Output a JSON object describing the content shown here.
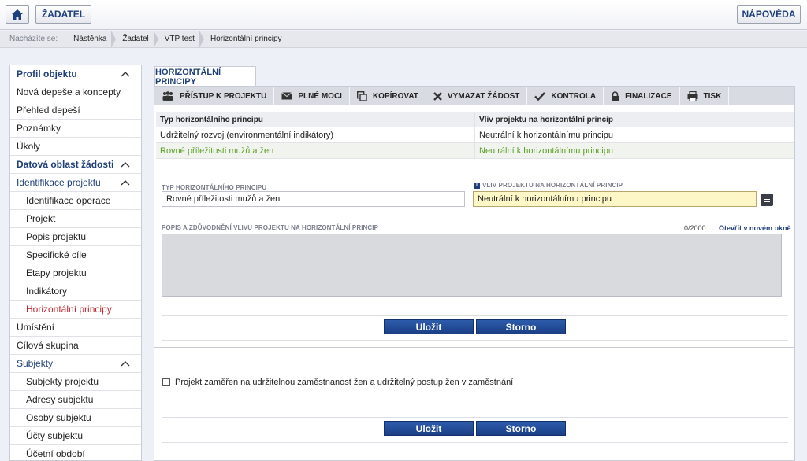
{
  "topbar": {
    "home_icon": "home-icon",
    "zadatel_label": "ŽADATEL",
    "napoveda_label": "NÁPOVĚDA"
  },
  "breadcrumb": {
    "lead": "Nacházíte se:",
    "items": [
      "Nástěnka",
      "Žadatel",
      "VTP test",
      "Horizontální principy"
    ]
  },
  "sidebar": {
    "items": [
      {
        "label": "Profil objektu"
      },
      {
        "label": "Nová depeše a koncepty"
      },
      {
        "label": "Přehled depeší"
      },
      {
        "label": "Poznámky"
      },
      {
        "label": "Úkoly"
      },
      {
        "label": "Datová oblast žádosti"
      },
      {
        "label": "Identifikace projektu"
      },
      {
        "label": "Identifikace operace"
      },
      {
        "label": "Projekt"
      },
      {
        "label": "Popis projektu"
      },
      {
        "label": "Specifické cíle"
      },
      {
        "label": "Etapy projektu"
      },
      {
        "label": "Indikátory"
      },
      {
        "label": "Horizontální principy"
      },
      {
        "label": "Umístění"
      },
      {
        "label": "Cílová skupina"
      },
      {
        "label": "Subjekty"
      },
      {
        "label": "Subjekty projektu"
      },
      {
        "label": "Adresy subjektu"
      },
      {
        "label": "Osoby subjektu"
      },
      {
        "label": "Účty subjektu"
      },
      {
        "label": "Účetní období"
      }
    ]
  },
  "tab": {
    "title": "HORIZONTÁLNÍ PRINCIPY"
  },
  "toolbar": {
    "items": [
      {
        "label": "PŘÍSTUP K PROJEKTU",
        "icon": "people-icon"
      },
      {
        "label": "PLNÉ MOCI",
        "icon": "envelope-icon"
      },
      {
        "label": "KOPÍROVAT",
        "icon": "copy-icon"
      },
      {
        "label": "VYMAZAT ŽÁDOST",
        "icon": "close-icon"
      },
      {
        "label": "KONTROLA",
        "icon": "check-icon"
      },
      {
        "label": "FINALIZACE",
        "icon": "lock-icon"
      },
      {
        "label": "TISK",
        "icon": "printer-icon"
      }
    ]
  },
  "grid": {
    "columns": [
      "Typ horizontálního principu",
      "Vliv projektu na horizontální princip"
    ],
    "rows": [
      [
        "Udržitelný rozvoj (environmentální indikátory)",
        "Neutrální k horizontálnímu principu"
      ],
      [
        "Rovné příležitosti mužů a žen",
        "Neutrální k horizontálnímu principu"
      ]
    ],
    "selected_color": "#5a9f24"
  },
  "form": {
    "type_label": "TYP HORIZONTÁLNÍHO PRINCIPU",
    "type_value": "Rovné příležitosti mužů a žen",
    "influence_label": "VLIV PROJEKTU NA HORIZONTÁLNÍ PRINCIP",
    "influence_value": "Neutrální k horizontálnímu principu",
    "description_label": "POPIS A ZDŮVODNĚNÍ VLIVU PROJEKTU NA HORIZONTÁLNÍ PRINCIP",
    "counter": "0/2000",
    "open_link": "Otevřít v novém okně",
    "save_label": "Uložit",
    "cancel_label": "Storno"
  },
  "second_form": {
    "checkbox_label": "Projekt zaměřen na udržitelnou zaměstnanost žen a udržitelný postup žen v zaměstnání",
    "save_label": "Uložit",
    "cancel_label": "Storno"
  },
  "colors": {
    "accent": "#1f3f7a",
    "active_nav": "#c0262d",
    "button": "#1c3f86"
  }
}
